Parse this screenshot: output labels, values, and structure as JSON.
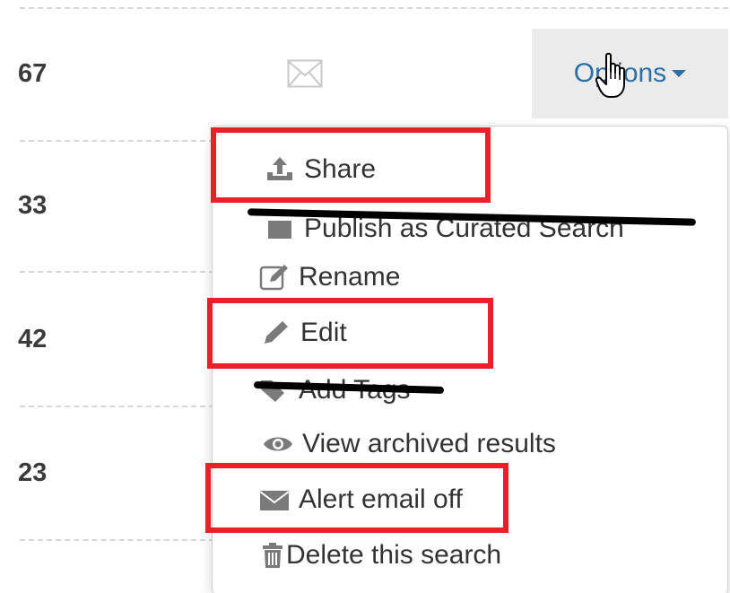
{
  "rows": [
    {
      "count": "67"
    },
    {
      "count": "33"
    },
    {
      "count": "42"
    },
    {
      "count": "23"
    }
  ],
  "options": {
    "label": "Options"
  },
  "menu": {
    "items": [
      {
        "label": "Share",
        "icon": "share-upload-icon"
      },
      {
        "label": "Publish as Curated Search",
        "icon": "publish-icon",
        "struck": true
      },
      {
        "label": "Rename",
        "icon": "rename-edit-box-icon"
      },
      {
        "label": "Edit",
        "icon": "pencil-icon"
      },
      {
        "label": "Add Tags",
        "icon": "tags-icon",
        "struck": true
      },
      {
        "label": "View archived results",
        "icon": "eye-icon"
      },
      {
        "label": "Alert email off",
        "icon": "envelope-icon"
      },
      {
        "label": "Delete this search",
        "icon": "trash-icon"
      }
    ]
  },
  "colors": {
    "link": "#2d6fa4",
    "highlight": "#e8202a",
    "options_bg": "#ebebeb"
  }
}
